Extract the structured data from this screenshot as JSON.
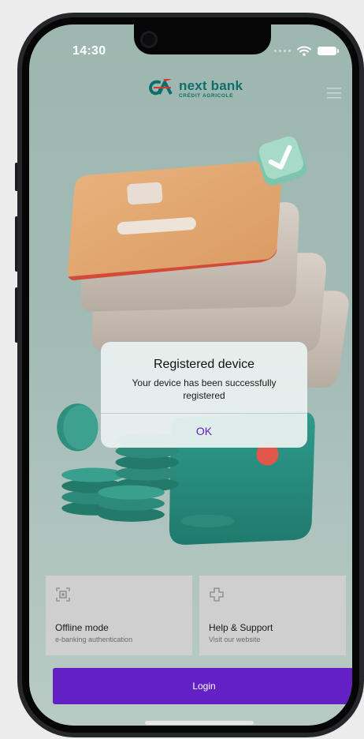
{
  "status_bar": {
    "time": "14:30"
  },
  "brand": {
    "name": "next bank",
    "subtitle": "CRÉDIT AGRICOLE",
    "color": "#0e6e6c"
  },
  "icons": {
    "menu": "hamburger-menu-icon",
    "offline": "qr-code-icon",
    "help": "plus-outline-icon",
    "wifi": "wifi-icon",
    "battery": "battery-icon"
  },
  "tiles": [
    {
      "title": "Offline mode",
      "subtitle": "e-banking authentication"
    },
    {
      "title": "Help & Support",
      "subtitle": "Visit our website"
    }
  ],
  "login": {
    "label": "Login",
    "color": "#6320c4"
  },
  "alert": {
    "title": "Registered device",
    "message": "Your device has been successfully registered",
    "ok_label": "OK"
  }
}
